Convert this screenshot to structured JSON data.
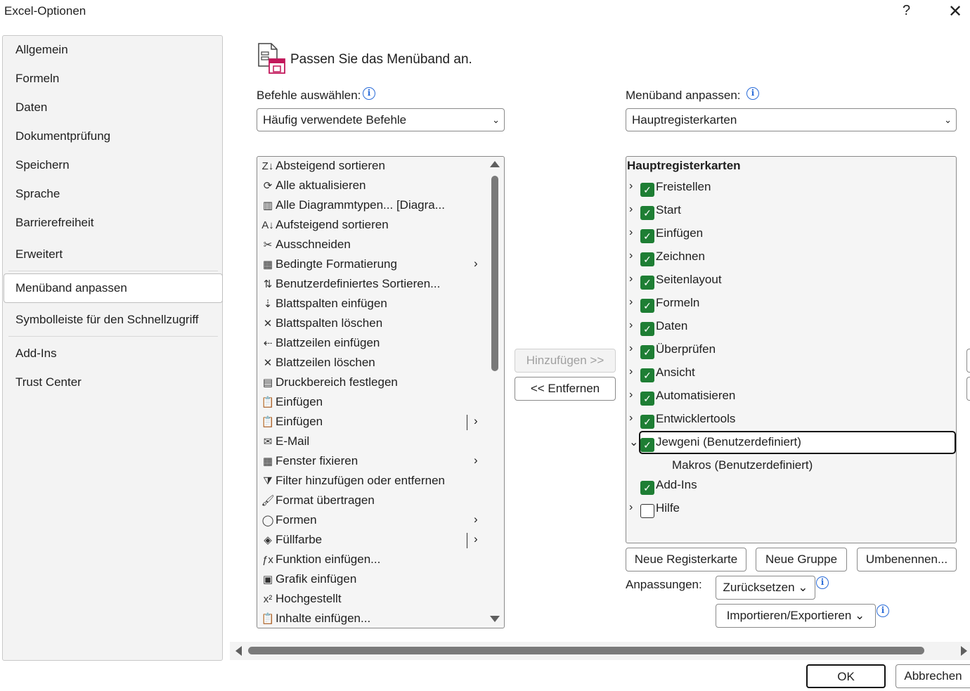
{
  "window": {
    "title": "Excel-Optionen",
    "help": "?",
    "close": "✕"
  },
  "sidebar": {
    "items": [
      {
        "label": "Allgemein"
      },
      {
        "label": "Formeln"
      },
      {
        "label": "Daten"
      },
      {
        "label": "Dokumentprüfung"
      },
      {
        "label": "Speichern"
      },
      {
        "label": "Sprache"
      },
      {
        "label": "Barrierefreiheit"
      },
      {
        "label": "Erweitert"
      },
      {
        "label": "Menüband anpassen"
      },
      {
        "label": "Symbolleiste für den Schnellzugriff"
      },
      {
        "label": "Add-Ins"
      },
      {
        "label": "Trust Center"
      }
    ],
    "selected": "Menüband anpassen"
  },
  "main": {
    "title": "Passen Sie das Menüband an.",
    "commands": {
      "label": "Befehle auswählen:",
      "selected": "Häufig verwendete Befehle",
      "items": [
        {
          "label": "Absteigend sortieren",
          "icon": "Z↓"
        },
        {
          "label": "Alle aktualisieren",
          "icon": "⟳"
        },
        {
          "label": "Alle Diagrammtypen... [Diagra...",
          "icon": "▥"
        },
        {
          "label": "Aufsteigend sortieren",
          "icon": "A↓"
        },
        {
          "label": "Ausschneiden",
          "icon": "✂"
        },
        {
          "label": "Bedingte Formatierung",
          "icon": "▦",
          "sub": "›"
        },
        {
          "label": "Benutzerdefiniertes Sortieren...",
          "icon": "⇅"
        },
        {
          "label": "Blattspalten einfügen",
          "icon": "⇣"
        },
        {
          "label": "Blattspalten löschen",
          "icon": "✕"
        },
        {
          "label": "Blattzeilen einfügen",
          "icon": "⇠"
        },
        {
          "label": "Blattzeilen löschen",
          "icon": "✕"
        },
        {
          "label": "Druckbereich festlegen",
          "icon": "▤"
        },
        {
          "label": "Einfügen",
          "icon": "📋"
        },
        {
          "label": "Einfügen",
          "icon": "📋",
          "sub": "›",
          "split": true
        },
        {
          "label": "E-Mail",
          "icon": "✉"
        },
        {
          "label": "Fenster fixieren",
          "icon": "▦",
          "sub": "›"
        },
        {
          "label": "Filter hinzufügen oder entfernen",
          "icon": "⧩"
        },
        {
          "label": "Format übertragen",
          "icon": "🖌"
        },
        {
          "label": "Formen",
          "icon": "◯",
          "sub": "›"
        },
        {
          "label": "Füllfarbe",
          "icon": "◈",
          "sub": "›",
          "split": true
        },
        {
          "label": "Funktion einfügen...",
          "icon": "ƒx"
        },
        {
          "label": "Grafik einfügen",
          "icon": "▣"
        },
        {
          "label": "Hochgestellt",
          "icon": "x²"
        },
        {
          "label": "Inhalte einfügen...",
          "icon": "📋"
        }
      ]
    },
    "buttons": {
      "add": "Hinzufügen >>",
      "remove": "<< Entfernen"
    },
    "ribbon": {
      "label": "Menüband anpassen:",
      "selected": "Hauptregisterkarten",
      "header": "Hauptregisterkarten",
      "tabs": [
        {
          "label": "Freistellen",
          "checked": true,
          "expand": "›"
        },
        {
          "label": "Start",
          "checked": true,
          "expand": "›"
        },
        {
          "label": "Einfügen",
          "checked": true,
          "expand": "›"
        },
        {
          "label": "Zeichnen",
          "checked": true,
          "expand": "›"
        },
        {
          "label": "Seitenlayout",
          "checked": true,
          "expand": "›"
        },
        {
          "label": "Formeln",
          "checked": true,
          "expand": "›"
        },
        {
          "label": "Daten",
          "checked": true,
          "expand": "›"
        },
        {
          "label": "Überprüfen",
          "checked": true,
          "expand": "›"
        },
        {
          "label": "Ansicht",
          "checked": true,
          "expand": "›"
        },
        {
          "label": "Automatisieren",
          "checked": true,
          "expand": "›"
        },
        {
          "label": "Entwicklertools",
          "checked": true,
          "expand": "›"
        },
        {
          "label": "Jewgeni (Benutzerdefiniert)",
          "checked": true,
          "expand": "⌄"
        },
        {
          "label": "Add-Ins",
          "checked": true,
          "expand": ""
        },
        {
          "label": "Hilfe",
          "checked": false,
          "expand": "›"
        }
      ],
      "group": "Makros (Benutzerdefiniert)"
    },
    "actions": {
      "new_tab": "Neue Registerkarte",
      "new_group": "Neue Gruppe",
      "rename": "Umbenennen...",
      "customizations_label": "Anpassungen:",
      "reset": "Zurücksetzen ⌄",
      "import_export": "Importieren/Exportieren ⌄"
    }
  },
  "footer": {
    "ok": "OK",
    "cancel": "Abbrechen"
  },
  "colors": {
    "check": "#1e7e34",
    "info": "#2b6cd8"
  }
}
